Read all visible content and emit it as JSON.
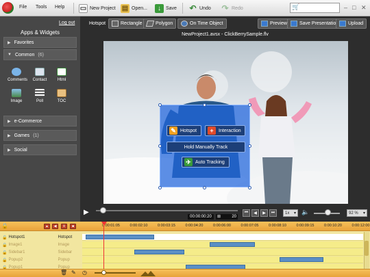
{
  "menu": {
    "file": "File",
    "tools": "Tools",
    "help": "Help"
  },
  "toolbar": {
    "new_project": "New Project",
    "open": "Open...",
    "save": "Save",
    "undo": "Undo",
    "redo": "Redo"
  },
  "sidebar": {
    "logout": "Log out",
    "title": "Apps & Widgets",
    "sections": [
      {
        "label": "Favorites",
        "count": ""
      },
      {
        "label": "Common",
        "count": "(6)"
      },
      {
        "label": "e-Commerce",
        "count": ""
      },
      {
        "label": "Games",
        "count": "(1)"
      },
      {
        "label": "Social",
        "count": ""
      }
    ],
    "widgets": [
      "Comments",
      "Contact",
      "Html",
      "Image",
      "Poll",
      "TOC"
    ]
  },
  "stage_toolbar": {
    "hotspot": "Hotspot",
    "rectangle": "Rectangle",
    "polygon": "Polygon",
    "on_time_object": "On Time Object",
    "preview": "Preview",
    "save_presentation": "Save Presentation",
    "upload": "Upload"
  },
  "file_title": "NewProject1.avsx - ClickBerrySample.flv",
  "hotspot_menu": {
    "hotspot": "Hotspot",
    "interaction": "Interaction",
    "hold_track": "Hold Manually Track",
    "auto_tracking": "Auto Tracking"
  },
  "playback": {
    "timecode": "00:00:00:20",
    "frame": "20",
    "speed": "1x",
    "zoom": "92 %"
  },
  "timeline": {
    "ticks": [
      "0:00:01:05",
      "0:00:02:10",
      "0:00:03:15",
      "0:00:04:20",
      "0:00:06:00",
      "0:00:07:05",
      "0:00:08:10",
      "0:00:09:15",
      "0:00:10:20",
      "0:00:12:00"
    ],
    "rows": [
      {
        "name": "Hotspot1",
        "type": "Hotspot",
        "selected": true,
        "faded": false
      },
      {
        "name": "Image1",
        "type": "Image",
        "selected": false,
        "faded": true
      },
      {
        "name": "Sidebar1",
        "type": "Sidebar",
        "selected": false,
        "faded": true
      },
      {
        "name": "Popup2",
        "type": "Popup",
        "selected": false,
        "faded": true
      },
      {
        "name": "Popup1",
        "type": "Popup",
        "selected": false,
        "faded": true
      }
    ]
  },
  "colors": {
    "hotspot_fill": "#1e64dc",
    "timeline_ruler": "#f6c15a",
    "clip": "#5b8fc5",
    "playhead": "#ee3333"
  }
}
